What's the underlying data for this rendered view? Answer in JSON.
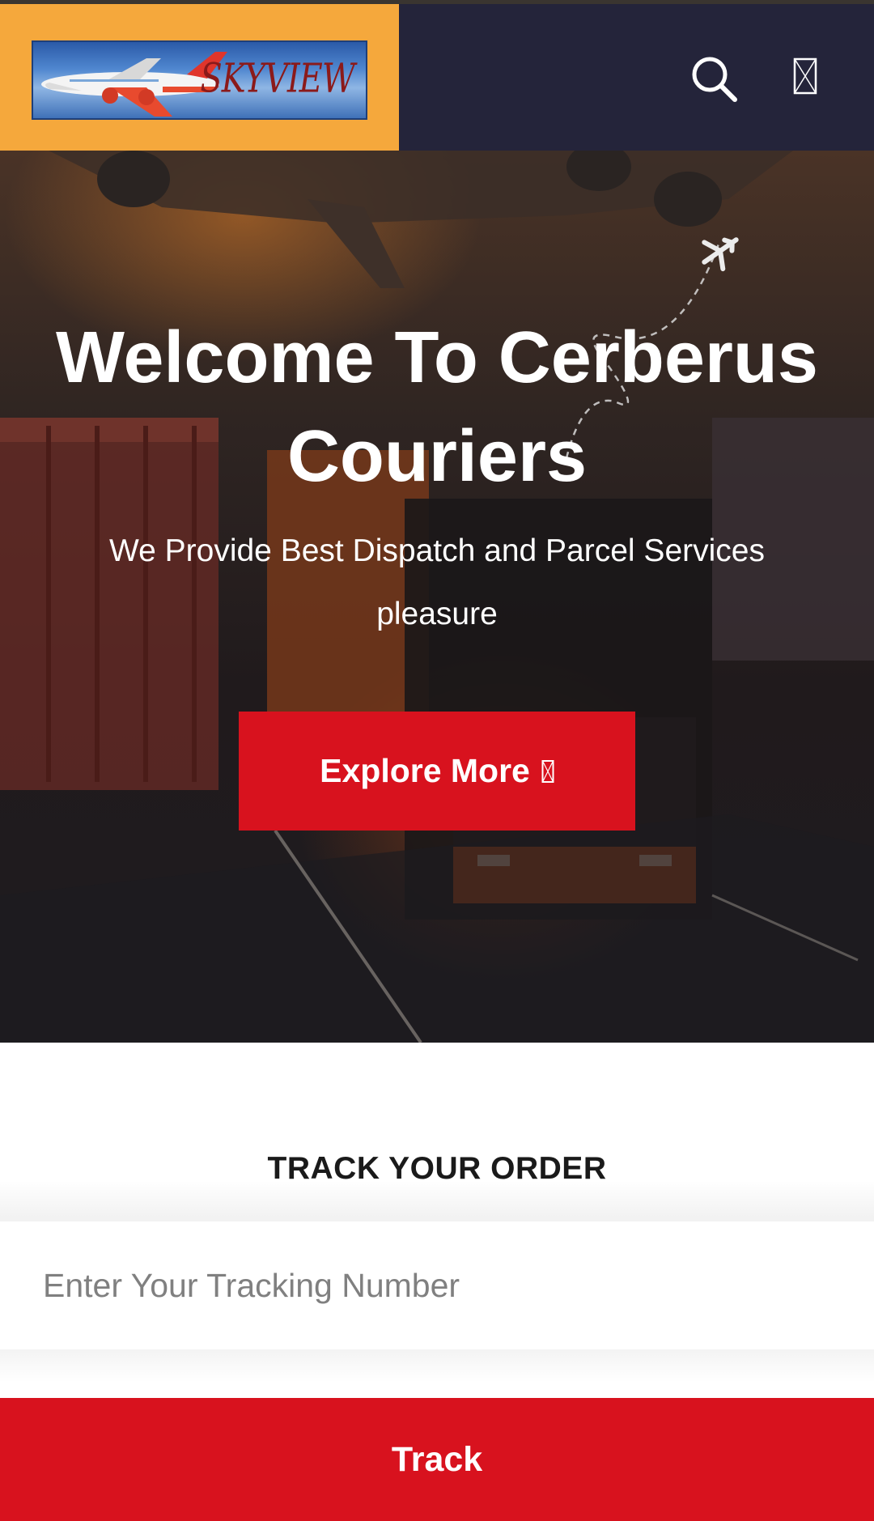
{
  "header": {
    "logo_text": "SKYVIEW",
    "search_icon": "search-icon",
    "menu_icon": "menu-icon",
    "colors": {
      "bar": "#24243a",
      "logo_bg": "#f5a83c"
    }
  },
  "hero": {
    "title": "Welcome To Cerberus Couriers",
    "subtitle": "We Provide Best Dispatch and Parcel Services pleasure",
    "cta_label": "Explore More",
    "cta_icon": "arrow-right-icon",
    "accent": "#d8121e"
  },
  "track": {
    "heading": "TRACK YOUR ORDER",
    "placeholder": "Enter Your Tracking Number",
    "button_label": "Track"
  }
}
